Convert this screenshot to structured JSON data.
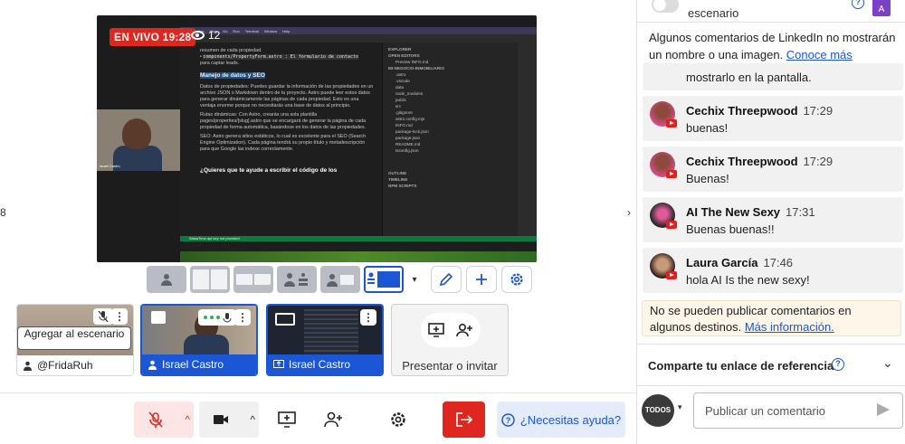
{
  "stage": {
    "live_label": "EN VIVO 19:28",
    "viewer_count": "12",
    "camera_name": "Israel Castro",
    "menubar_items": [
      "Selection",
      "View",
      "Go",
      "Run",
      "Terminal",
      "Window",
      "Help"
    ],
    "doc_lines": [
      "resumen de cada propiedad.",
      "components/PropertyForm.astro : El formulario de contacto",
      "para captar leads."
    ],
    "doc_heading": "Manejo de datos y SEO",
    "doc_bullets": [
      "Datos de propiedades: Puedes guardar la información de las propiedades en un archivo JSON o Markdown dentro de tu proyecto. Astro puede leer estos datos para generar dinámicamente las páginas de cada propiedad. Esto es una ventaja enorme porque no necesitarás una base de datos al principio.",
      "Rutas dinámicas: Con Astro, crearás una sola plantilla pages/properties/[slug].astro que se encargará de generar la página de cada propiedad de forma automática, basándose en los datos de las propiedades.",
      "SEO: Astro genera sitios estáticos, lo cual es excelente para el SEO (Search Engine Optimization). Cada página tendrá su propio título y metadescripción para que Google las indexe correctamente."
    ],
    "doc_question": "¿Quieres que te ayude a escribir el código de los",
    "explorer": {
      "title": "EXPLORER",
      "open_editors": "OPEN EDITORS",
      "open_file": "Preview INFO.md",
      "project": "MI-NEGOCIO-INMOBILIARIO",
      "files": [
        ".astro",
        ".vscode",
        "data",
        "node_modules",
        "public",
        "src",
        ".gitignore",
        "astro.config.mjs",
        "INFO.md",
        "package-lock.json",
        "package.json",
        "README.md",
        "tsconfig.json"
      ],
      "outline": "OUTLINE",
      "timeline": "TIMELINE",
      "npm": "NPM SCRIPTS"
    },
    "status_text": "WakaTime api key not provided"
  },
  "tiles": [
    {
      "name": "@FridaRuh",
      "action": "Agregar al escenario"
    },
    {
      "name": "Israel Castro"
    },
    {
      "name": "Israel Castro"
    }
  ],
  "present": {
    "label": "Presentar o invitar"
  },
  "help_button": "¿Necesitas ayuda?",
  "chat": {
    "toggle_label": "escenario",
    "account_initial": "A",
    "notice": "Algunos comentarios de LinkedIn no mostrarán un nombre o una imagen.",
    "notice_link": "Conoce más",
    "partial_text": "mostrarlo en la pantalla.",
    "messages": [
      {
        "author": "Cechix Threepwood",
        "time": "17:29",
        "text": "buenas!"
      },
      {
        "author": "Cechix Threepwood",
        "time": "17:29",
        "text": "Buenas!"
      },
      {
        "author": "AI The New Sexy",
        "time": "17:31",
        "text": "Buenas buenas!!"
      },
      {
        "author": "Laura García",
        "time": "17:46",
        "text": "hola AI Is the new sexy!"
      }
    ],
    "warning": "No se pueden publicar comentarios en algunos destinos.",
    "warning_link": "Más información.",
    "referral": "Comparte tu enlace de referencia",
    "audience": "TODOS",
    "composer_placeholder": "Publicar un comentario"
  },
  "colors": {
    "accent": "#1a56d6",
    "live": "#e0271f",
    "leave": "#e0271f",
    "mute_bg": "#fde5e5"
  }
}
